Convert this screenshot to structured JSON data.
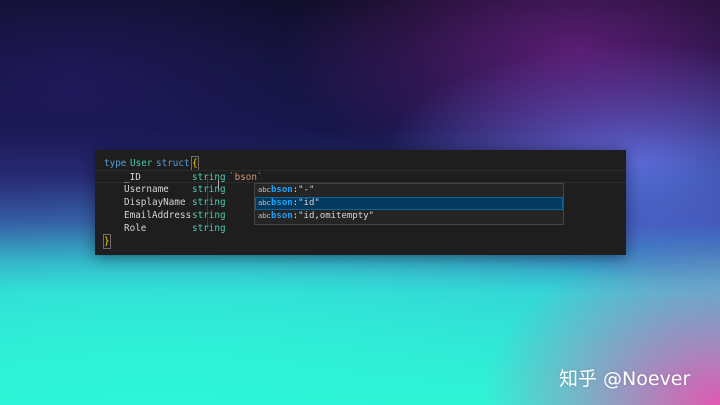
{
  "editor": {
    "lines": [
      {
        "kw": "type",
        "name": "User",
        "kw2": "struct",
        "brace": "{"
      },
      {
        "field": "_ID",
        "type": "string",
        "tag": "`bson`"
      },
      {
        "field": "Username",
        "type": "string"
      },
      {
        "field": "DisplayName",
        "type": "string"
      },
      {
        "field": "EmailAddress",
        "type": "string"
      },
      {
        "field": "Role",
        "type": "string"
      },
      {
        "brace": "}"
      }
    ]
  },
  "suggestions": {
    "items": [
      {
        "kind": "abc",
        "prefix": "bson",
        "rest": ":\"-\""
      },
      {
        "kind": "abc",
        "prefix": "bson",
        "rest": ":\"id\""
      },
      {
        "kind": "abc",
        "prefix": "bson",
        "rest": ":\"id,omitempty\""
      }
    ],
    "selected_index": 1
  },
  "watermark": "知乎 @Noever",
  "colors": {
    "editor_bg": "#1e1e1e",
    "keyword": "#569cd6",
    "type": "#4ec9b0",
    "string": "#ce9178",
    "brace": "#ffd700",
    "match_highlight": "#18a3ff",
    "selection_bg": "#04395e"
  }
}
